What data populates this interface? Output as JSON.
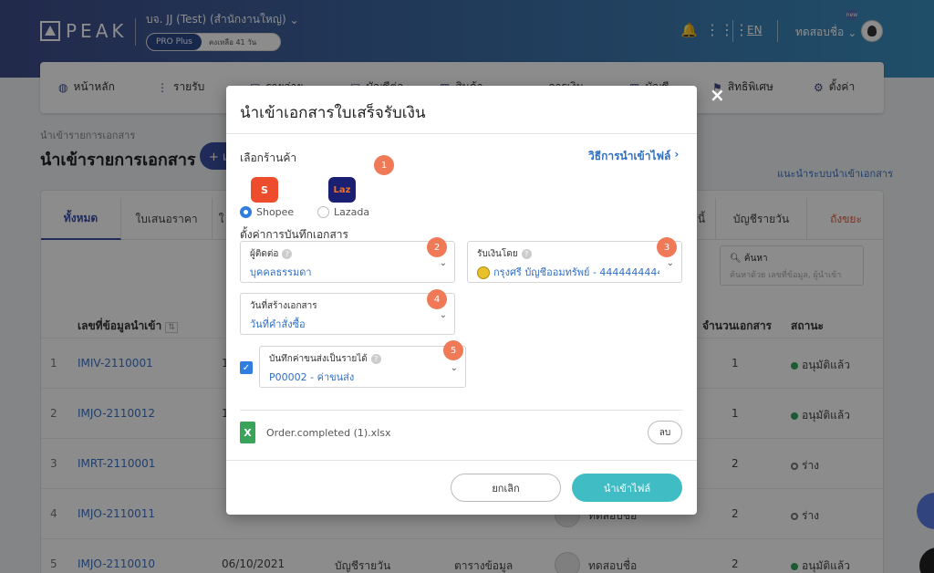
{
  "header": {
    "logo_text": "PEAK",
    "company_name": "บจ. JJ (Test) (สำนักงานใหญ่)",
    "plan_name": "PRO Plus",
    "plan_days_left": "คงเหลือ 41 วัน",
    "language": "EN",
    "user_name": "ทดสอบชื่อ",
    "badge": "new"
  },
  "nav": {
    "items": [
      {
        "label": "หน้าหลัก"
      },
      {
        "label": "รายรับ"
      },
      {
        "label": "รายจ่าย"
      },
      {
        "label": "บัญชีต่อ"
      },
      {
        "label": "สินค้า"
      },
      {
        "label": "การเงิน"
      },
      {
        "label": "บัญชี"
      },
      {
        "label": "สิทธิพิเศษ"
      },
      {
        "label": "ตั้งค่า"
      }
    ]
  },
  "page": {
    "breadcrumb": "นำเข้ารายการเอกสาร",
    "title": "นำเข้ารายการเอกสาร",
    "add_label": "+ เ",
    "help_link": "แนะนำระบบนำเข้าเอกสาร",
    "tabs": [
      "ทั้งหมด",
      "ใบเสนอราคา",
      "ใ",
      "หนี้",
      "บัญชีรายวัน",
      "ถังขยะ"
    ],
    "search_label": "ค้นหา",
    "search_placeholder": "ค้นหาด้วย เลขที่ข้อมูล, ผู้นำเข้า",
    "columns": {
      "doc_no": "เลขที่ข้อมูลนำเข้า",
      "doc_count": "จำนวนเอกสาร",
      "status": "สถานะ"
    },
    "rows": [
      {
        "idx": "1",
        "doc_no": "IMIV-2110001",
        "col2": "1",
        "col3": "",
        "col4": "",
        "count": "1",
        "status": "อนุมัติแล้ว",
        "approved": true
      },
      {
        "idx": "2",
        "doc_no": "IMJO-2110012",
        "col2": "1",
        "col3": "",
        "col4": "",
        "count": "1",
        "status": "อนุมัติแล้ว",
        "approved": true
      },
      {
        "idx": "3",
        "doc_no": "IMRT-2110001",
        "col2": "",
        "col3": "",
        "col4": "",
        "count": "2",
        "status": "ร่าง",
        "approved": false
      },
      {
        "idx": "4",
        "doc_no": "IMJO-2110011",
        "col2": "",
        "col3": "",
        "col4": "ทดสอบชื่อ",
        "count": "2",
        "status": "ร่าง",
        "approved": false
      },
      {
        "idx": "5",
        "doc_no": "IMJO-2110010",
        "col2": "06/10/2021",
        "col3": "บัญชีรายวัน",
        "col4": "ตารางข้อมูล",
        "user": "ทดสอบชื่อ",
        "count": "2",
        "status": "อนุมัติแล้ว",
        "approved": true
      }
    ]
  },
  "modal": {
    "title": "นำเข้าเอกสารใบเสร็จรับเงิน",
    "select_store_label": "เลือกร้านค้า",
    "how_to_link": "วิธีการนำเข้าไฟล์",
    "stores": [
      {
        "name": "Shopee",
        "logo": "S",
        "selected": true,
        "color": "#ee4d2d"
      },
      {
        "name": "Lazada",
        "logo": "Laz",
        "selected": false,
        "color": "#1a1f71"
      }
    ],
    "settings_label": "ตั้งค่าการบันทึกเอกสาร",
    "fields": {
      "contact": {
        "label": "ผู้ติดต่อ",
        "value": "บุคคลธรรมดา"
      },
      "received_by": {
        "label": "รับเงินโดย",
        "value": "กรุงศรี บัญชีออมทรัพย์ - 4444444444"
      },
      "doc_date": {
        "label": "วันที่สร้างเอกสาร",
        "value": "วันที่คำสั่งซื้อ"
      },
      "shipping": {
        "label": "บันทึกค่าขนส่งเป็นรายได้",
        "value": "P00002 - ค่าขนส่ง",
        "checked": true
      }
    },
    "steps": [
      "1",
      "2",
      "3",
      "4",
      "5"
    ],
    "file_name": "Order.completed (1).xlsx",
    "file_icon": "X",
    "delete_label": "ลบ",
    "cancel_label": "ยกเลิก",
    "import_label": "นำเข้าไฟล์",
    "close_icon": "×"
  },
  "colors": {
    "accent": "#3d4fa3",
    "link": "#2f6fc4",
    "primary_button": "#3fbcc4",
    "step_badge": "#f07a57"
  }
}
